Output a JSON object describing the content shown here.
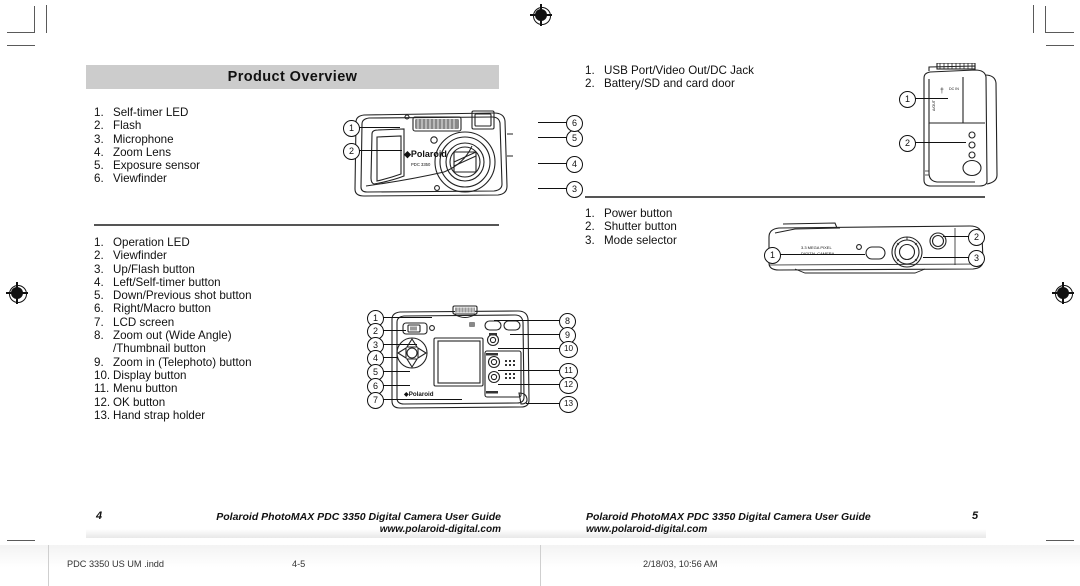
{
  "document": {
    "title": "Product Overview"
  },
  "left_page": {
    "section_title": "Product Overview",
    "front_view": {
      "caption_items": [
        {
          "num": "1.",
          "label": "Self-timer LED"
        },
        {
          "num": "2.",
          "label": "Flash"
        },
        {
          "num": "3.",
          "label": "Microphone"
        },
        {
          "num": "4.",
          "label": "Zoom Lens"
        },
        {
          "num": "5.",
          "label": "Exposure sensor"
        },
        {
          "num": "6.",
          "label": "Viewfinder"
        }
      ],
      "callout_numbers": [
        "1",
        "2",
        "3",
        "4",
        "5",
        "6"
      ],
      "brand": "Polaroid",
      "model": "PDC 3350"
    },
    "back_view": {
      "caption_items": [
        {
          "num": "1.",
          "label": "Operation LED"
        },
        {
          "num": "2.",
          "label": "Viewfinder"
        },
        {
          "num": "3.",
          "label": "Up/Flash button"
        },
        {
          "num": "4.",
          "label": "Left/Self-timer button"
        },
        {
          "num": "5.",
          "label": "Down/Previous shot button"
        },
        {
          "num": "6.",
          "label": "Right/Macro button"
        },
        {
          "num": "7.",
          "label": "LCD screen"
        },
        {
          "num": "8.",
          "label": "Zoom out (Wide Angle)"
        },
        {
          "num": "",
          "label": "/Thumbnail button"
        },
        {
          "num": "9.",
          "label": "Zoom in (Telephoto) button"
        },
        {
          "num": "10.",
          "label": "Display button"
        },
        {
          "num": "11.",
          "label": "Menu button"
        },
        {
          "num": "12.",
          "label": "OK button"
        },
        {
          "num": "13.",
          "label": "Hand strap holder"
        }
      ],
      "callout_numbers_left": [
        "1",
        "2",
        "3",
        "4",
        "5",
        "6",
        "7"
      ],
      "callout_numbers_right": [
        "8",
        "9",
        "10",
        "11",
        "12",
        "13"
      ],
      "brand": "Polaroid"
    },
    "footer": {
      "page_number": "4",
      "line1": "Polaroid PhotoMAX PDC 3350 Digital Camera User Guide",
      "line2": "www.polaroid-digital.com"
    }
  },
  "right_page": {
    "side_view": {
      "caption_items": [
        {
          "num": "1.",
          "label": "USB Port/Video Out/DC Jack"
        },
        {
          "num": "2.",
          "label": "Battery/SD and card door"
        }
      ],
      "callout_numbers": [
        "1",
        "2"
      ],
      "port_labels": [
        "DC IN",
        "A/OUT"
      ]
    },
    "top_view": {
      "caption_items": [
        {
          "num": "1.",
          "label": "Power button"
        },
        {
          "num": "2.",
          "label": "Shutter button"
        },
        {
          "num": "3.",
          "label": "Mode selector"
        }
      ],
      "callout_numbers": [
        "1",
        "2",
        "3"
      ],
      "body_text": [
        "3.3 MEGA PIXEL",
        "DIGITAL CAMERA"
      ]
    },
    "footer": {
      "page_number": "5",
      "line1": "Polaroid PhotoMAX PDC 3350 Digital Camera User Guide",
      "line2": "www.polaroid-digital.com"
    }
  },
  "print_bar": {
    "filename": "PDC 3350 US UM .indd",
    "spread": "4-5",
    "timestamp": "2/18/03, 10:56 AM"
  },
  "colors": {
    "title_bar": "#cccccc",
    "rule": "#555555",
    "text": "#111111"
  }
}
